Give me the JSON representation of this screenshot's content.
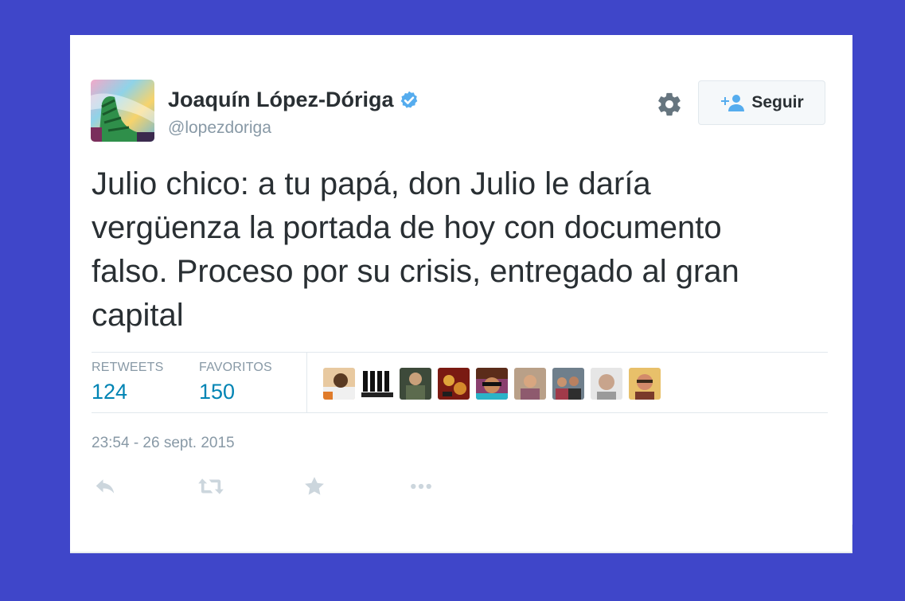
{
  "tweet": {
    "author": {
      "name": "Joaquín López-Dóriga",
      "handle": "@lopezdoriga",
      "verified": true
    },
    "follow_button": {
      "label": "Seguir",
      "icon": "add-user-icon"
    },
    "settings_icon": "gear-icon",
    "text": "Julio chico: a tu papá, don Julio le daría vergüenza la portada de hoy con documento falso. Proceso por su crisis, entregado al gran capital",
    "stats": [
      {
        "label": "RETWEETS",
        "value": "124"
      },
      {
        "label": "FAVORITOS",
        "value": "150"
      }
    ],
    "favoriters_count": 9,
    "timestamp": "23:54 - 26 sept. 2015",
    "actions": [
      "reply-icon",
      "retweet-icon",
      "favorite-icon",
      "more-icon"
    ]
  },
  "colors": {
    "background": "#3f46c9",
    "link": "#0084b4",
    "verified": "#55acee",
    "muted": "#8899a6",
    "text": "#292f33"
  }
}
